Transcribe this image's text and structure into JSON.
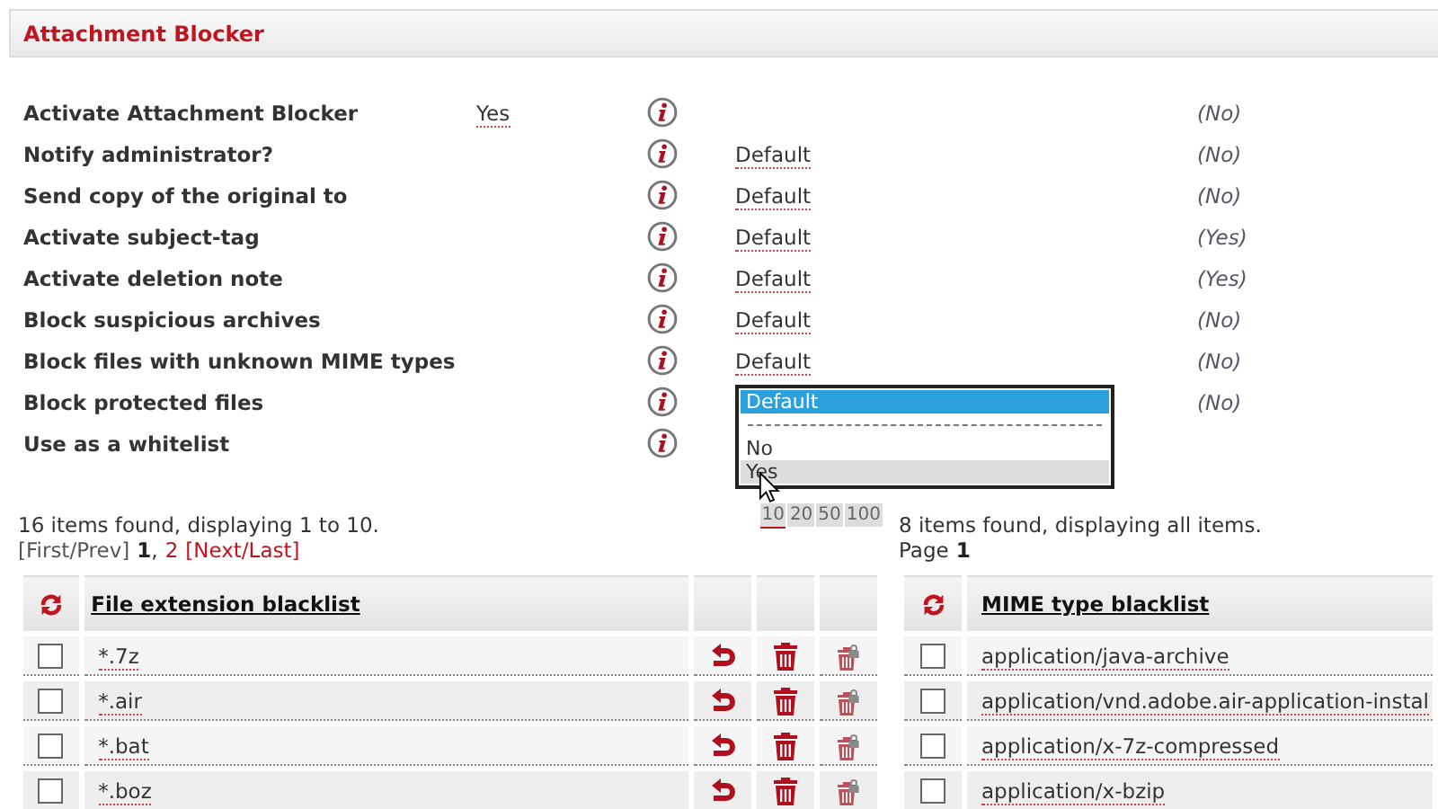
{
  "panel": {
    "title": "Attachment Blocker"
  },
  "settings": [
    {
      "label": "Activate Attachment Blocker",
      "kind": "main",
      "value": "Yes",
      "default_hint": "(No)"
    },
    {
      "label": "Notify administrator?",
      "kind": "option",
      "value": "Default",
      "default_hint": "(No)"
    },
    {
      "label": "Send copy of the original to",
      "kind": "option",
      "value": "Default",
      "default_hint": "(No)"
    },
    {
      "label": "Activate subject-tag",
      "kind": "option",
      "value": "Default",
      "default_hint": "(Yes)"
    },
    {
      "label": "Activate deletion note",
      "kind": "option",
      "value": "Default",
      "default_hint": "(Yes)"
    },
    {
      "label": "Block suspicious archives",
      "kind": "option",
      "value": "Default",
      "default_hint": "(No)"
    },
    {
      "label": "Block files with unknown MIME types",
      "kind": "option",
      "value": "Default",
      "default_hint": "(No)"
    },
    {
      "label": "Block protected files",
      "kind": "option",
      "default_hint": "(No)"
    },
    {
      "label": "Use as a whitelist",
      "kind": "option"
    }
  ],
  "dropdown": {
    "options": [
      {
        "label": "Default",
        "kind": "option",
        "selected": true,
        "hovered": false
      },
      {
        "kind": "separator"
      },
      {
        "label": "No",
        "kind": "option",
        "selected": false,
        "hovered": false
      },
      {
        "label": "Yes",
        "kind": "option",
        "selected": false,
        "hovered": true
      }
    ]
  },
  "file_list": {
    "summary": "16 items found, displaying 1 to 10.",
    "first_prev": "[First/Prev]",
    "pages": [
      {
        "label": "1",
        "selected": true
      },
      {
        "label": "2",
        "selected": false
      }
    ],
    "separator": ",",
    "next_last": "[Next/Last]",
    "page_sizes": [
      {
        "label": "10",
        "selected": true
      },
      {
        "label": "20",
        "selected": false
      },
      {
        "label": "50",
        "selected": false
      },
      {
        "label": "100",
        "selected": false
      }
    ],
    "title": "File extension blacklist",
    "rows": [
      {
        "name": "*.7z",
        "checked": false
      },
      {
        "name": "*.air",
        "checked": false
      },
      {
        "name": "*.bat",
        "checked": false
      },
      {
        "name": "*.boz",
        "checked": false
      }
    ]
  },
  "mime_list": {
    "summary": "8 items found, displaying all items.",
    "page_label": "Page",
    "page": "1",
    "title": "MIME type blacklist",
    "rows": [
      {
        "name": "application/java-archive",
        "checked": false
      },
      {
        "name": "application/vnd.adobe.air-application-instal",
        "checked": false
      },
      {
        "name": "application/x-7z-compressed",
        "checked": false
      },
      {
        "name": "application/x-bzip",
        "checked": false
      }
    ]
  }
}
